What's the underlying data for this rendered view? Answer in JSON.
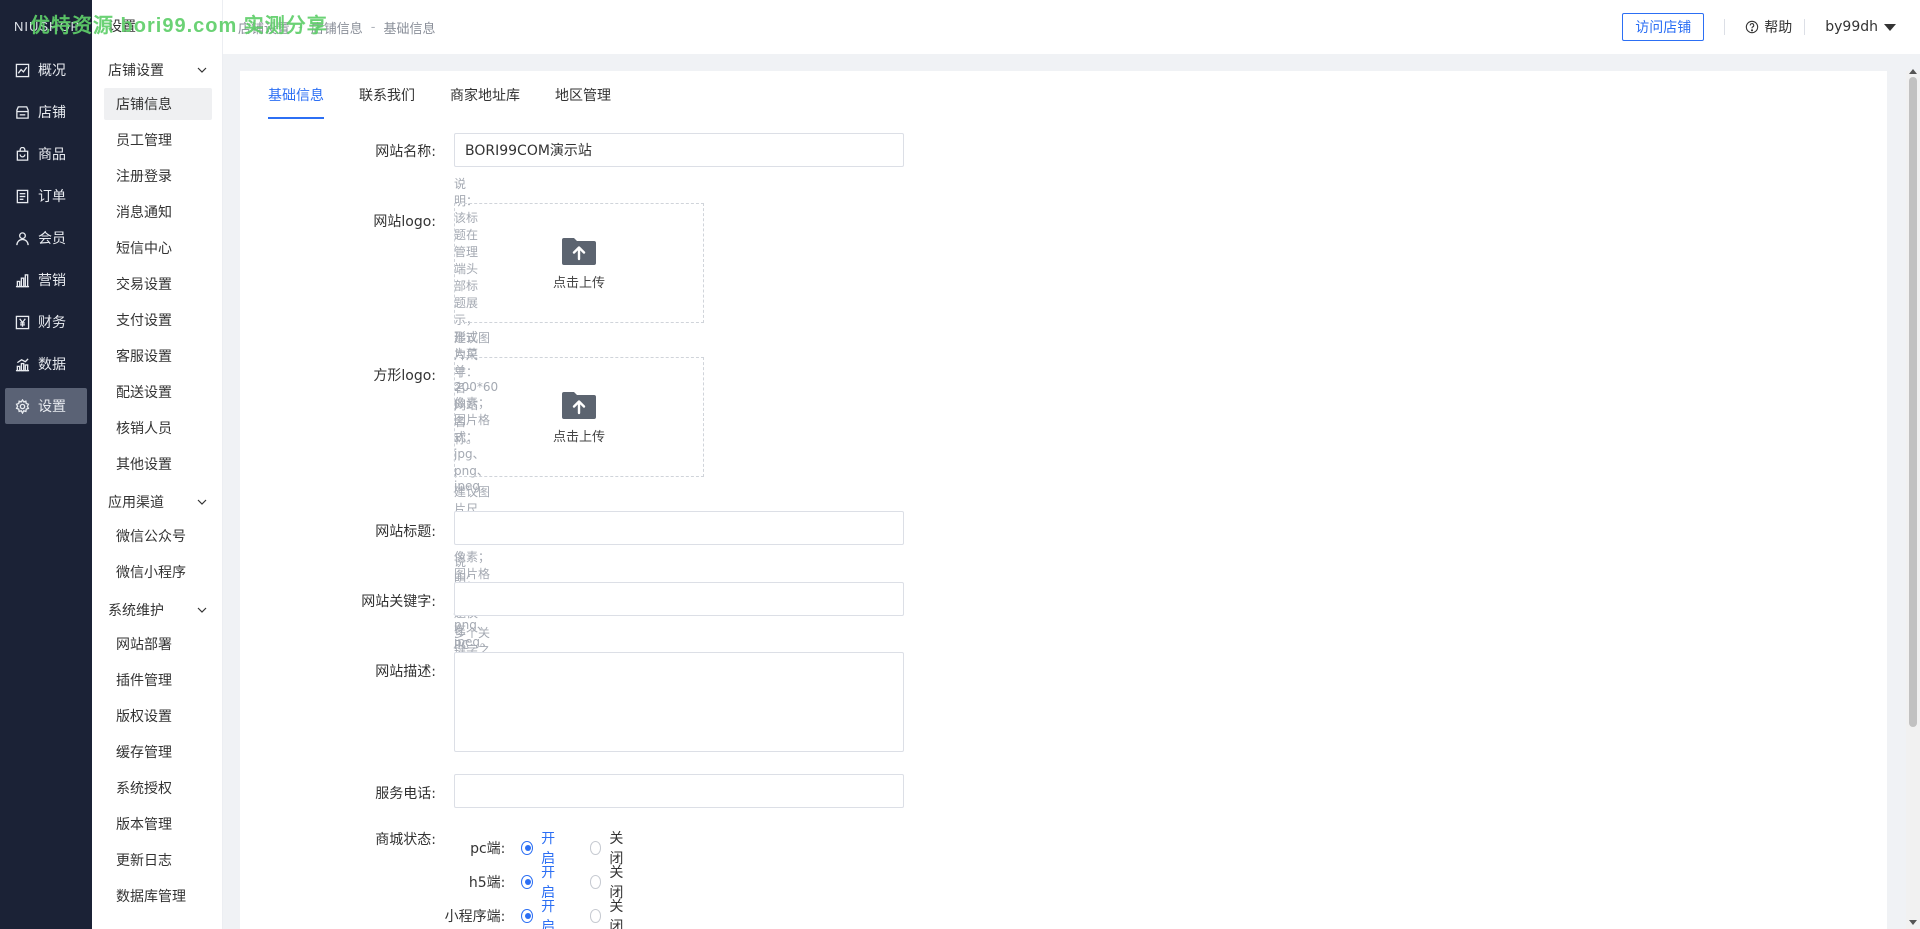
{
  "watermark": "优特资源 bori99.com 实测分享",
  "nav": {
    "logo": "NIUSHOP",
    "items": [
      {
        "label": "概况",
        "icon": "chart-line-icon"
      },
      {
        "label": "店铺",
        "icon": "store-icon"
      },
      {
        "label": "商品",
        "icon": "bag-icon"
      },
      {
        "label": "订单",
        "icon": "document-icon"
      },
      {
        "label": "会员",
        "icon": "user-icon"
      },
      {
        "label": "营销",
        "icon": "bar-chart-icon"
      },
      {
        "label": "财务",
        "icon": "yuan-icon"
      },
      {
        "label": "数据",
        "icon": "data-chart-icon"
      },
      {
        "label": "设置",
        "icon": "gear-icon"
      }
    ]
  },
  "subnav": {
    "top": "设置",
    "groups": [
      {
        "label": "店铺设置",
        "items": [
          "店铺信息",
          "员工管理",
          "注册登录",
          "消息通知",
          "短信中心",
          "交易设置",
          "支付设置",
          "客服设置",
          "配送设置",
          "核销人员",
          "其他设置"
        ]
      },
      {
        "label": "应用渠道",
        "items": [
          "微信公众号",
          "微信小程序"
        ]
      },
      {
        "label": "系统维护",
        "items": [
          "网站部署",
          "插件管理",
          "版权设置",
          "缓存管理",
          "系统授权",
          "版本管理",
          "更新日志",
          "数据库管理"
        ]
      }
    ]
  },
  "header": {
    "breadcrumb": [
      "店铺设置",
      "店铺信息",
      "基础信息"
    ],
    "visit_button": "访问店铺",
    "help": "帮助",
    "user": "by99dh"
  },
  "tabs": [
    "基础信息",
    "联系我们",
    "商家地址库",
    "地区管理"
  ],
  "form": {
    "site_name_label": "网站名称:",
    "site_name_value": "BORI99COM演示站",
    "site_name_hint": "说明：该标题在管理端头部标题展示，形式为菜单名-网站名称。",
    "logo_label": "网站logo:",
    "upload_text": "点击上传",
    "logo_hint": "建议图片尺寸：200*60像素；图片格式：jpg、png、jpeg",
    "square_logo_label": "方形logo:",
    "square_logo_hint": "建议图片尺寸：80*80像素；图片格式：jpg、png、jpeg。用于分享使用。",
    "site_title_label": "网站标题:",
    "site_title_hint": "说明：该标题仅在PC端首页标题展示",
    "keywords_label": "网站关键字:",
    "keywords_hint": "多个关键字之间用英文\",\"隔开",
    "desc_label": "网站描述:",
    "phone_label": "服务电话:",
    "status_label": "商城状态:",
    "status_rows": [
      {
        "platform": "pc端:",
        "on": "开启",
        "off": "关闭"
      },
      {
        "platform": "h5端:",
        "on": "开启",
        "off": "关闭"
      },
      {
        "platform": "小程序端:",
        "on": "开启",
        "off": "关闭"
      }
    ]
  },
  "colors": {
    "primary": "#2c6ff4",
    "nav_bg": "#1b2236",
    "watermark": "#5fcf6a"
  }
}
